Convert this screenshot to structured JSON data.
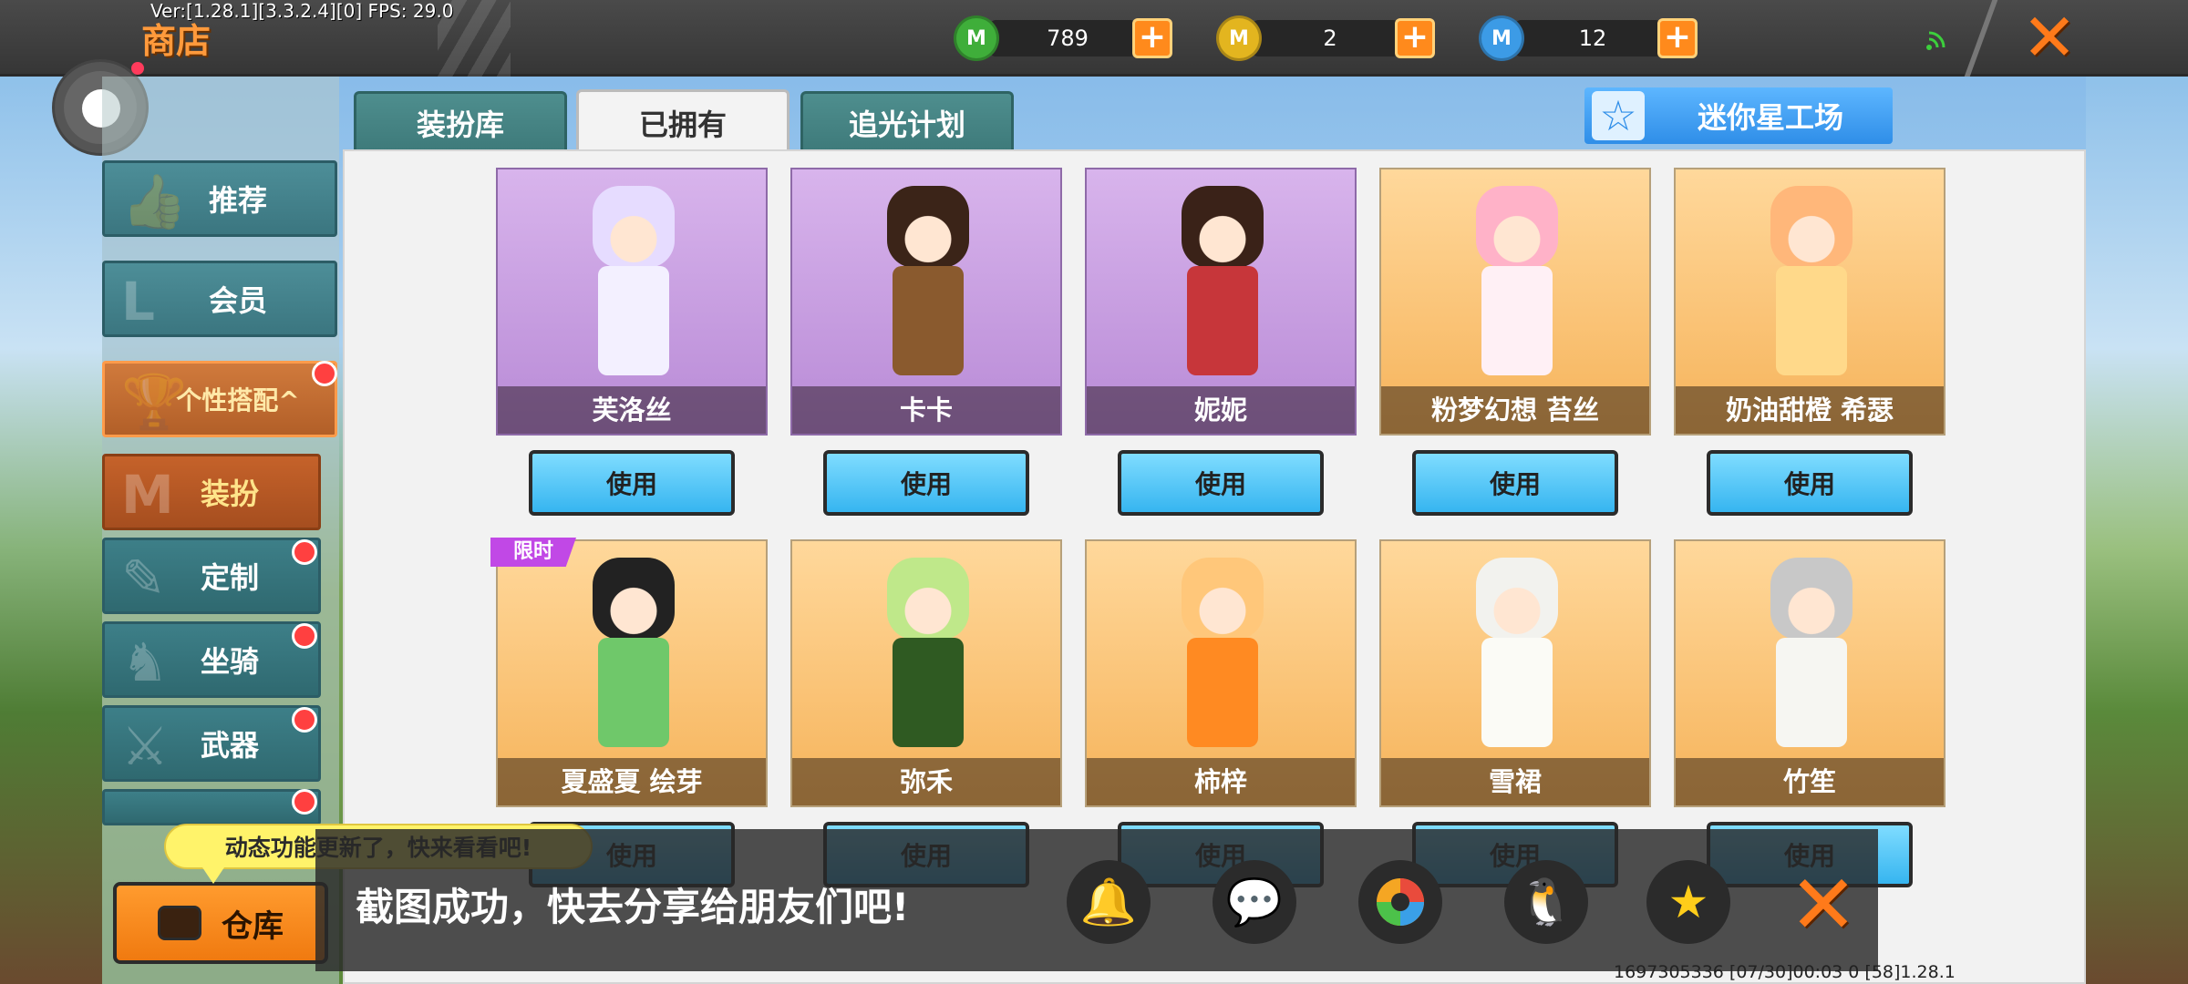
{
  "debug": "Ver:[1.28.1][3.3.2.4][0] FPS: 29.0",
  "header": {
    "title": "商店",
    "currencies": [
      {
        "icon": "green-mini-coin-icon",
        "color": "#3fae3a",
        "amount": "789"
      },
      {
        "icon": "gold-mini-coin-icon",
        "color": "#e3b51f",
        "amount": "2"
      },
      {
        "icon": "blue-mini-coin-icon",
        "color": "#3c9be6",
        "amount": "12"
      }
    ],
    "plus_symbol": "+",
    "close_symbol": "✕"
  },
  "tabs": [
    {
      "label": "装扮库",
      "active": false
    },
    {
      "label": "已拥有",
      "active": true
    },
    {
      "label": "追光计划",
      "active": false
    }
  ],
  "star_workshop": {
    "label": "迷你星工场",
    "icon": "☆"
  },
  "sidebar": {
    "items": [
      {
        "label": "推荐",
        "icon": "👍"
      },
      {
        "label": "会员",
        "icon": "L"
      },
      {
        "label": "个性搭配^",
        "icon": "🏆"
      },
      {
        "label": "装扮",
        "icon": "M"
      },
      {
        "label": "定制",
        "icon": "✎"
      },
      {
        "label": "坐骑",
        "icon": "♞"
      },
      {
        "label": "武器",
        "icon": "⚔"
      }
    ],
    "warehouse": "仓库"
  },
  "tooltip": "动态功能更新了，快来看看吧!",
  "cards": [
    {
      "name": "芙洛丝",
      "style": "purple",
      "hair": "#e6dcff",
      "outfit": "#f3f0ff"
    },
    {
      "name": "卡卡",
      "style": "purple",
      "hair": "#3b2418",
      "outfit": "#8a5a2e"
    },
    {
      "name": "妮妮",
      "style": "purple",
      "hair": "#3a2218",
      "outfit": "#c7363a"
    },
    {
      "name": "粉梦幻想 苔丝",
      "style": "orange",
      "hair": "#ffb2c8",
      "outfit": "#fff0f5"
    },
    {
      "name": "奶油甜橙 希瑟",
      "style": "orange",
      "hair": "#ffb77a",
      "outfit": "#ffd98a"
    },
    {
      "name": "夏盛夏 绘芽",
      "style": "orange",
      "hair": "#222222",
      "outfit": "#6fc86a",
      "badge": "限时"
    },
    {
      "name": "弥禾",
      "style": "orange",
      "hair": "#bfe88a",
      "outfit": "#2f5a22"
    },
    {
      "name": "柿梓",
      "style": "orange",
      "hair": "#ffc77a",
      "outfit": "#ff8a22"
    },
    {
      "name": "雪裙",
      "style": "orange",
      "hair": "#f2f2ee",
      "outfit": "#fbfbf6"
    },
    {
      "name": "竹笙",
      "style": "orange",
      "hair": "#c8c8c8",
      "outfit": "#f6f6f2"
    }
  ],
  "use_label": "使用",
  "share": {
    "text": "截图成功，快去分享给朋友们吧!",
    "icons": [
      "bell-icon",
      "wechat-icon",
      "moments-icon",
      "qq-icon",
      "qzone-icon"
    ]
  },
  "bottom_info": "1697305336   [07/30]00:03 0 [58]1.28.1"
}
